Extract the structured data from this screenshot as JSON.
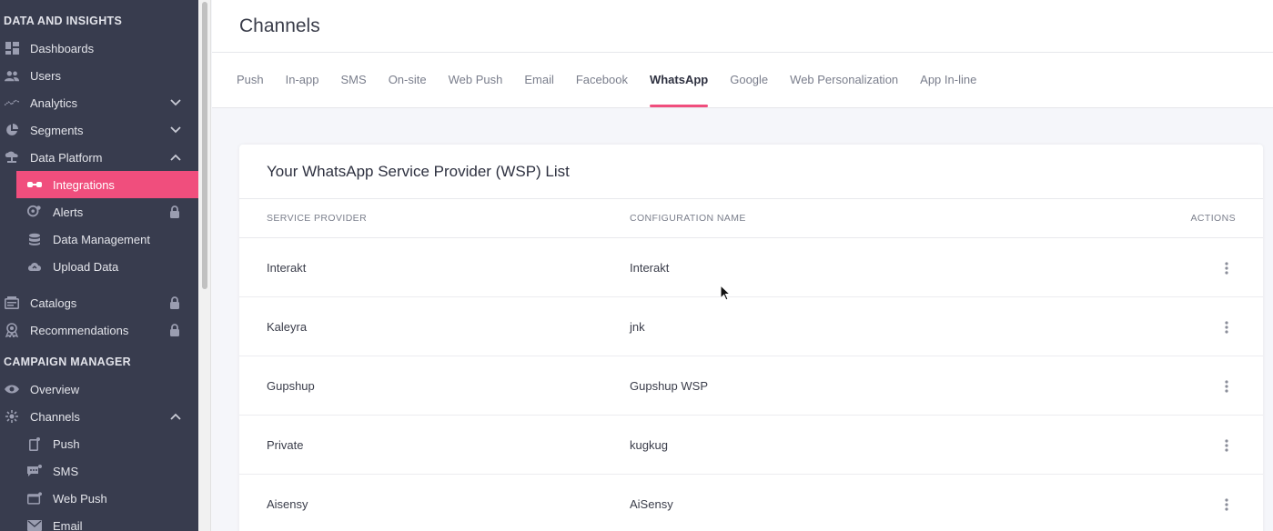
{
  "sidebar": {
    "section1": "DATA AND INSIGHTS",
    "section2": "CAMPAIGN MANAGER",
    "items": [
      {
        "label": "Dashboards"
      },
      {
        "label": "Users"
      },
      {
        "label": "Analytics"
      },
      {
        "label": "Segments"
      },
      {
        "label": "Data Platform"
      },
      {
        "label": "Integrations"
      },
      {
        "label": "Alerts"
      },
      {
        "label": "Data Management"
      },
      {
        "label": "Upload Data"
      },
      {
        "label": "Catalogs"
      },
      {
        "label": "Recommendations"
      },
      {
        "label": "Overview"
      },
      {
        "label": "Channels"
      },
      {
        "label": "Push"
      },
      {
        "label": "SMS"
      },
      {
        "label": "Web Push"
      },
      {
        "label": "Email"
      }
    ]
  },
  "header": {
    "title": "Channels"
  },
  "tabs": [
    {
      "label": "Push"
    },
    {
      "label": "In-app"
    },
    {
      "label": "SMS"
    },
    {
      "label": "On-site"
    },
    {
      "label": "Web Push"
    },
    {
      "label": "Email"
    },
    {
      "label": "Facebook"
    },
    {
      "label": "WhatsApp"
    },
    {
      "label": "Google"
    },
    {
      "label": "Web Personalization"
    },
    {
      "label": "App In-line"
    }
  ],
  "card": {
    "title": "Your WhatsApp Service Provider (WSP) List",
    "columns": {
      "provider": "SERVICE PROVIDER",
      "config": "CONFIGURATION NAME",
      "actions": "ACTIONS"
    },
    "rows": [
      {
        "provider": "Interakt",
        "config": "Interakt"
      },
      {
        "provider": "Kaleyra",
        "config": "jnk"
      },
      {
        "provider": "Gupshup",
        "config": "Gupshup WSP"
      },
      {
        "provider": "Private",
        "config": "kugkug"
      },
      {
        "provider": "Aisensy",
        "config": "AiSensy"
      }
    ]
  },
  "colors": {
    "accent": "#f04e7d",
    "sidebar": "#383c4e"
  }
}
